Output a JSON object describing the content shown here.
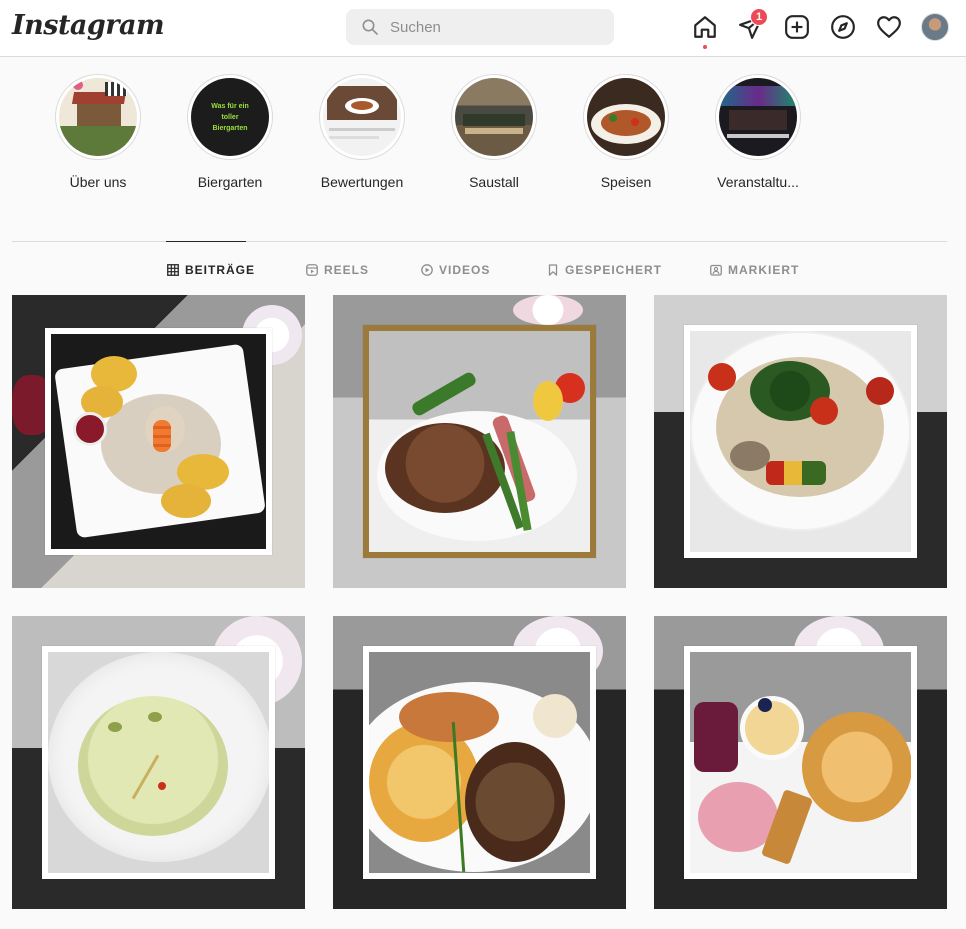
{
  "header": {
    "logo": "Instagram",
    "search_placeholder": "Suchen",
    "nav": [
      {
        "name": "home-icon"
      },
      {
        "name": "direct-icon",
        "badge": "1"
      },
      {
        "name": "new-post-icon"
      },
      {
        "name": "explore-icon"
      },
      {
        "name": "activity-icon"
      },
      {
        "name": "profile-avatar"
      }
    ]
  },
  "highlights": [
    {
      "label": "Über uns"
    },
    {
      "label": "Biergarten",
      "image_text": [
        "Was für ein",
        "toller",
        "Biergarten"
      ]
    },
    {
      "label": "Bewertungen"
    },
    {
      "label": "Saustall"
    },
    {
      "label": "Speisen"
    },
    {
      "label": "Veranstaltu..."
    }
  ],
  "tabs": [
    {
      "label": "BEITRÄGE",
      "icon": "grid-icon",
      "active": true
    },
    {
      "label": "REELS",
      "icon": "reels-icon"
    },
    {
      "label": "VIDEOS",
      "icon": "video-icon"
    },
    {
      "label": "GESPEICHERT",
      "icon": "bookmark-icon"
    },
    {
      "label": "MARKIERT",
      "icon": "tagged-icon"
    }
  ],
  "colors": {
    "accent_red": "#ed4956",
    "text": "#262626",
    "muted": "#8e8e8e",
    "border": "#dbdbdb",
    "background": "#fafafa"
  },
  "posts": [
    {
      "icon": "post-image-1"
    },
    {
      "icon": "post-image-2"
    },
    {
      "icon": "post-image-3"
    },
    {
      "icon": "post-image-4"
    },
    {
      "icon": "post-image-5"
    },
    {
      "icon": "post-image-6"
    }
  ]
}
